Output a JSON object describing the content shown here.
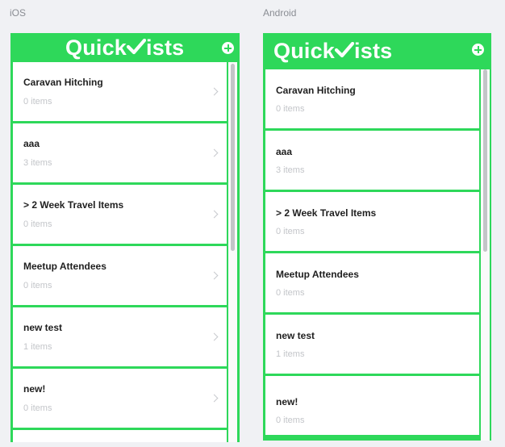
{
  "ios": {
    "platform_label": "iOS",
    "logo_part1": "Quick",
    "logo_part2": "ists",
    "add_icon": "plus-circle-icon",
    "items": [
      {
        "title": "Caravan Hitching",
        "count": "0 items"
      },
      {
        "title": "aaa",
        "count": "3 items"
      },
      {
        "title": "> 2 Week Travel Items",
        "count": "0 items"
      },
      {
        "title": "Meetup Attendees",
        "count": "0 items"
      },
      {
        "title": "new test",
        "count": "1 items"
      },
      {
        "title": "new!",
        "count": "0 items"
      }
    ]
  },
  "android": {
    "platform_label": "Android",
    "logo_part1": "Quick",
    "logo_part2": "ists",
    "add_icon": "plus-circle-icon",
    "items": [
      {
        "title": "Caravan Hitching",
        "count": "0 items"
      },
      {
        "title": "aaa",
        "count": "3 items"
      },
      {
        "title": "> 2 Week Travel Items",
        "count": "0 items"
      },
      {
        "title": "Meetup Attendees",
        "count": "0 items"
      },
      {
        "title": "new test",
        "count": "1 items"
      },
      {
        "title": "new!",
        "count": "0 items"
      }
    ]
  },
  "colors": {
    "brand_green": "#2ed85a",
    "background": "#f0f1f4"
  }
}
